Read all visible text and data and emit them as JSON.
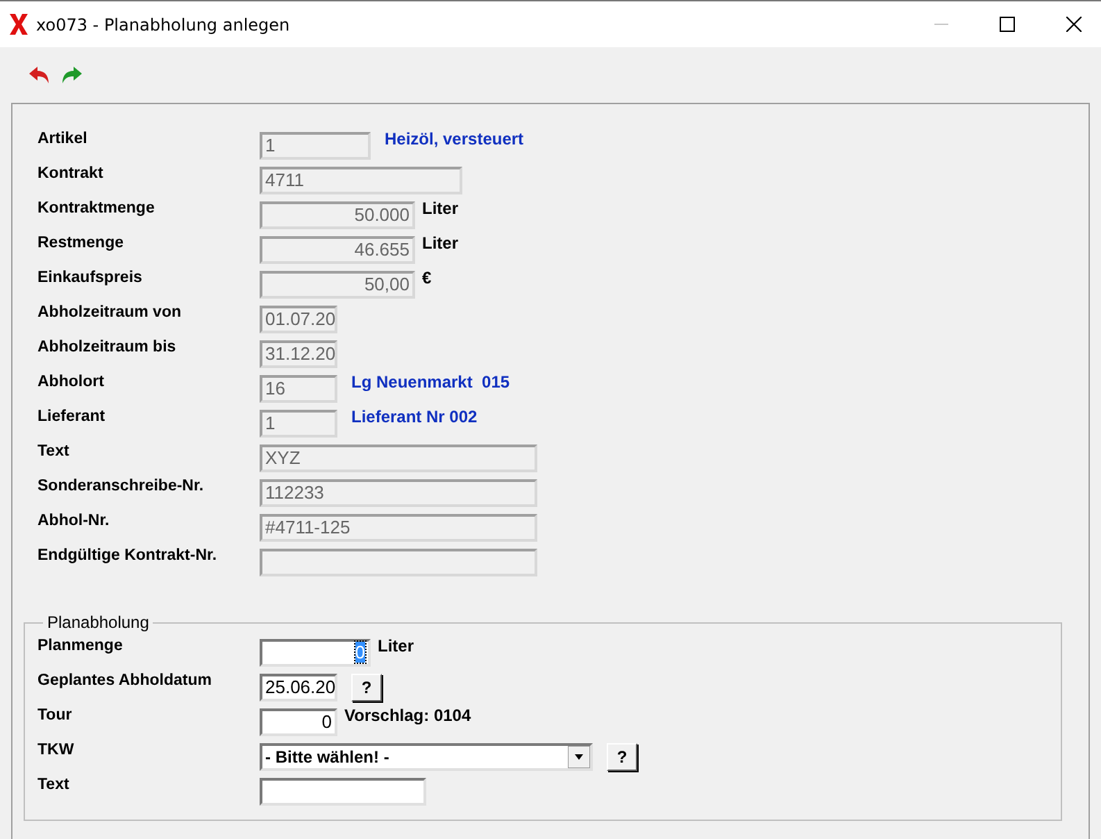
{
  "window": {
    "title": "xo073 - Planabholung anlegen",
    "minimize_disabled": true
  },
  "toolbar": [
    {
      "kind": "undo"
    },
    {
      "kind": "redo"
    }
  ],
  "fields": [
    {
      "label": "Artikel",
      "value": "1",
      "kind": "text",
      "disabled": true,
      "note": {
        "text": "Heizöl, versteuert",
        "kind": "info"
      }
    },
    {
      "label": "Kontrakt",
      "value": "4711",
      "kind": "text",
      "disabled": true
    },
    {
      "label": "Kontraktmenge",
      "value": "50.000",
      "kind": "number",
      "disabled": true,
      "note": {
        "text": "Liter",
        "kind": "unit"
      }
    },
    {
      "label": "Restmenge",
      "value": "46.655",
      "kind": "number",
      "disabled": true,
      "note": {
        "text": "Liter",
        "kind": "unit"
      }
    },
    {
      "label": "Einkaufspreis",
      "value": "50,00",
      "kind": "number",
      "disabled": true,
      "note": {
        "text": "€",
        "kind": "unit"
      }
    },
    {
      "label": "Abholzeitraum von",
      "value": "01.07.20",
      "kind": "text",
      "disabled": true
    },
    {
      "label": "Abholzeitraum bis",
      "value": "31.12.20",
      "kind": "text",
      "disabled": true
    },
    {
      "label": "Abholort",
      "value": "16",
      "kind": "text",
      "disabled": true,
      "note": {
        "text": "Lg Neuenmarkt  015",
        "kind": "info"
      }
    },
    {
      "label": "Lieferant",
      "value": "1",
      "kind": "text",
      "disabled": true,
      "note": {
        "text": "Lieferant Nr 002",
        "kind": "info"
      }
    },
    {
      "label": "Text",
      "value": "XYZ",
      "kind": "text",
      "disabled": true
    },
    {
      "label": "Sonderanschreibe-Nr.",
      "value": "112233",
      "kind": "text",
      "disabled": true
    },
    {
      "label": "Abhol-Nr.",
      "value": "#4711-125",
      "kind": "text",
      "disabled": true
    },
    {
      "label": "Endgültige Kontrakt-Nr.",
      "kind": "text",
      "disabled": true
    }
  ],
  "group": {
    "title": "Planabholung",
    "fields": [
      {
        "kind": "number",
        "label": "Planmenge",
        "value": "0",
        "disabled": false,
        "text_selected": true,
        "note": {
          "text": "Liter",
          "kind": "unit"
        }
      },
      {
        "kind": "text",
        "label": "Geplantes Abholdatum",
        "value": "25.06.20",
        "disabled": false,
        "button": "?"
      },
      {
        "kind": "number",
        "label": "Tour",
        "value": "0",
        "disabled": false,
        "note": {
          "text": "Vorschlag: 0104",
          "kind": "unit"
        }
      },
      {
        "kind": "select",
        "label": "TKW",
        "value": "- Bitte wählen! -",
        "disabled": false,
        "button": "?"
      },
      {
        "kind": "text",
        "label": "Text",
        "disabled": false
      }
    ]
  }
}
